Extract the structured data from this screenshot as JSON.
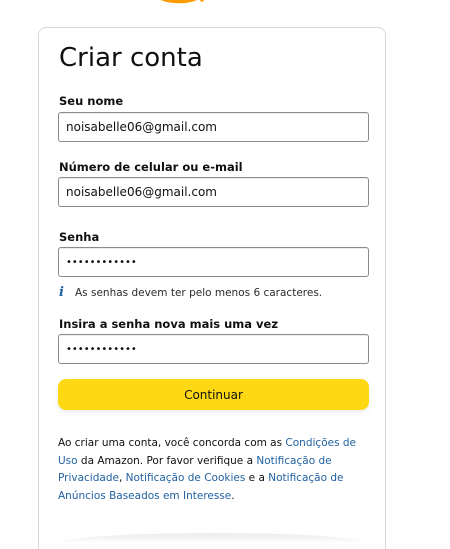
{
  "brand": {
    "accent_color": "#ff9900",
    "logo_icon": "amazon-smile-icon"
  },
  "form": {
    "title": "Criar conta",
    "name_label": "Seu nome",
    "name_value": "noisabelle06@gmail.com",
    "email_label": "Número de celular ou e-mail",
    "email_value": "noisabelle06@gmail.com",
    "password_label": "Senha",
    "password_value": "••••••••••••",
    "password_hint": "As senhas devem ter pelo menos 6 caracteres.",
    "password_hint_icon": "info-icon",
    "confirm_label": "Insira a senha nova mais uma vez",
    "confirm_value": "••••••••••••",
    "submit_label": "Continuar",
    "submit_color": "#ffd814"
  },
  "legal": {
    "text_1": "Ao criar uma conta, você concorda com as ",
    "link_conditions": "Condições de Uso",
    "text_2": " da Amazon. Por favor verifique a ",
    "link_privacy": "Notificação de Privacidade",
    "text_3": ", ",
    "link_cookies": "Notificação de Cookies",
    "text_4": " e a ",
    "link_ads": "Notificação de Anúncios Baseados em Interesse",
    "text_5": ".",
    "link_color": "#2162a1"
  }
}
